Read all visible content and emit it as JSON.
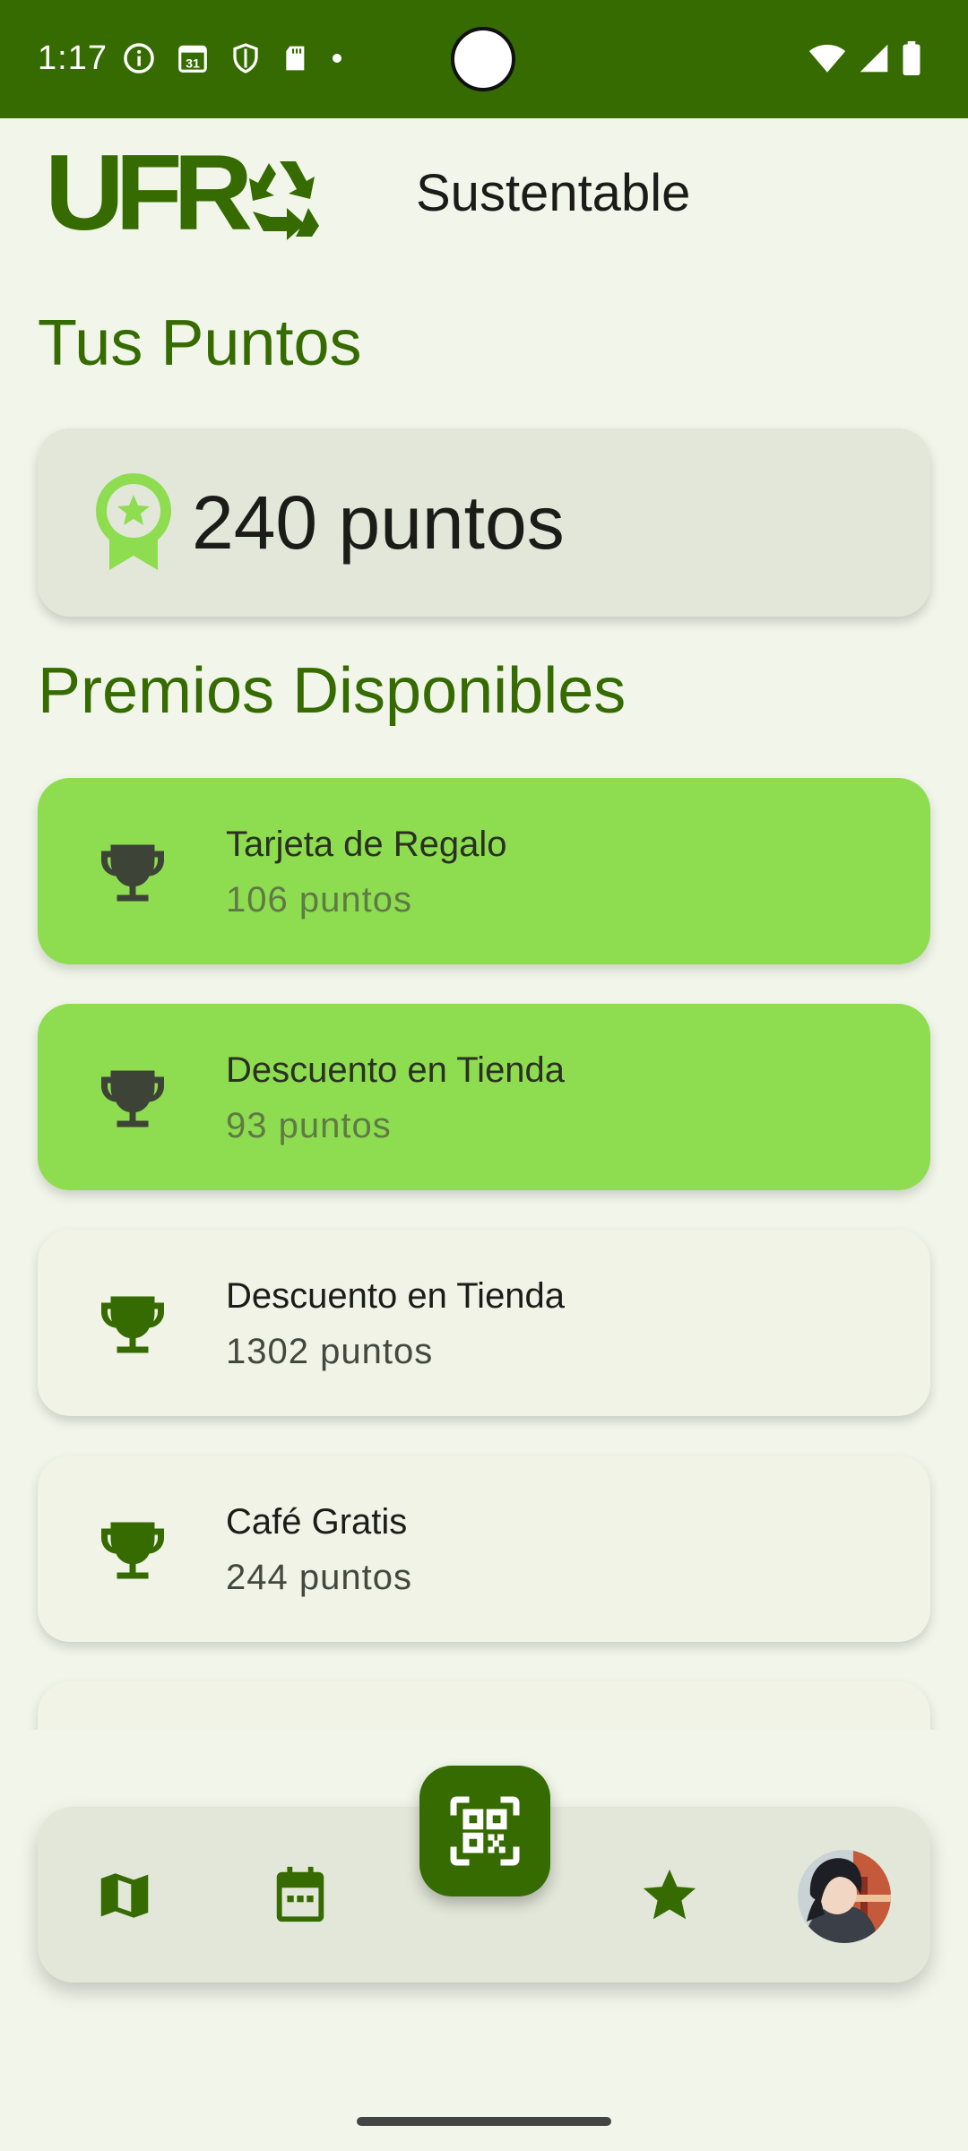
{
  "status_bar": {
    "time": "1:17",
    "calendar_day": "31",
    "left_icons": [
      "info-icon",
      "calendar-icon",
      "shield-icon",
      "sd-card-icon",
      "dot-icon"
    ],
    "right_icons": [
      "wifi-icon",
      "signal-icon",
      "battery-icon"
    ]
  },
  "header": {
    "logo_text": "UFR",
    "subtitle": "Sustentable"
  },
  "points": {
    "section_title": "Tus Puntos",
    "value": "240 puntos"
  },
  "prizes": {
    "section_title": "Premios Disponibles",
    "items": [
      {
        "name": "Tarjeta de Regalo",
        "cost": "106 puntos",
        "highlighted": true
      },
      {
        "name": "Descuento en Tienda",
        "cost": "93 puntos",
        "highlighted": true
      },
      {
        "name": "Descuento en Tienda",
        "cost": "1302 puntos",
        "highlighted": false
      },
      {
        "name": "Café Gratis",
        "cost": "244 puntos",
        "highlighted": false
      }
    ]
  },
  "bottom_nav": {
    "items": [
      "map-icon",
      "calendar-icon",
      "qr-scan-icon",
      "star-icon",
      "avatar"
    ]
  },
  "colors": {
    "primary": "#356b00",
    "background": "#f2f6ea",
    "card_surface": "#e3e7d9",
    "highlight": "#8edd50",
    "badge_light": "#8edd50"
  }
}
